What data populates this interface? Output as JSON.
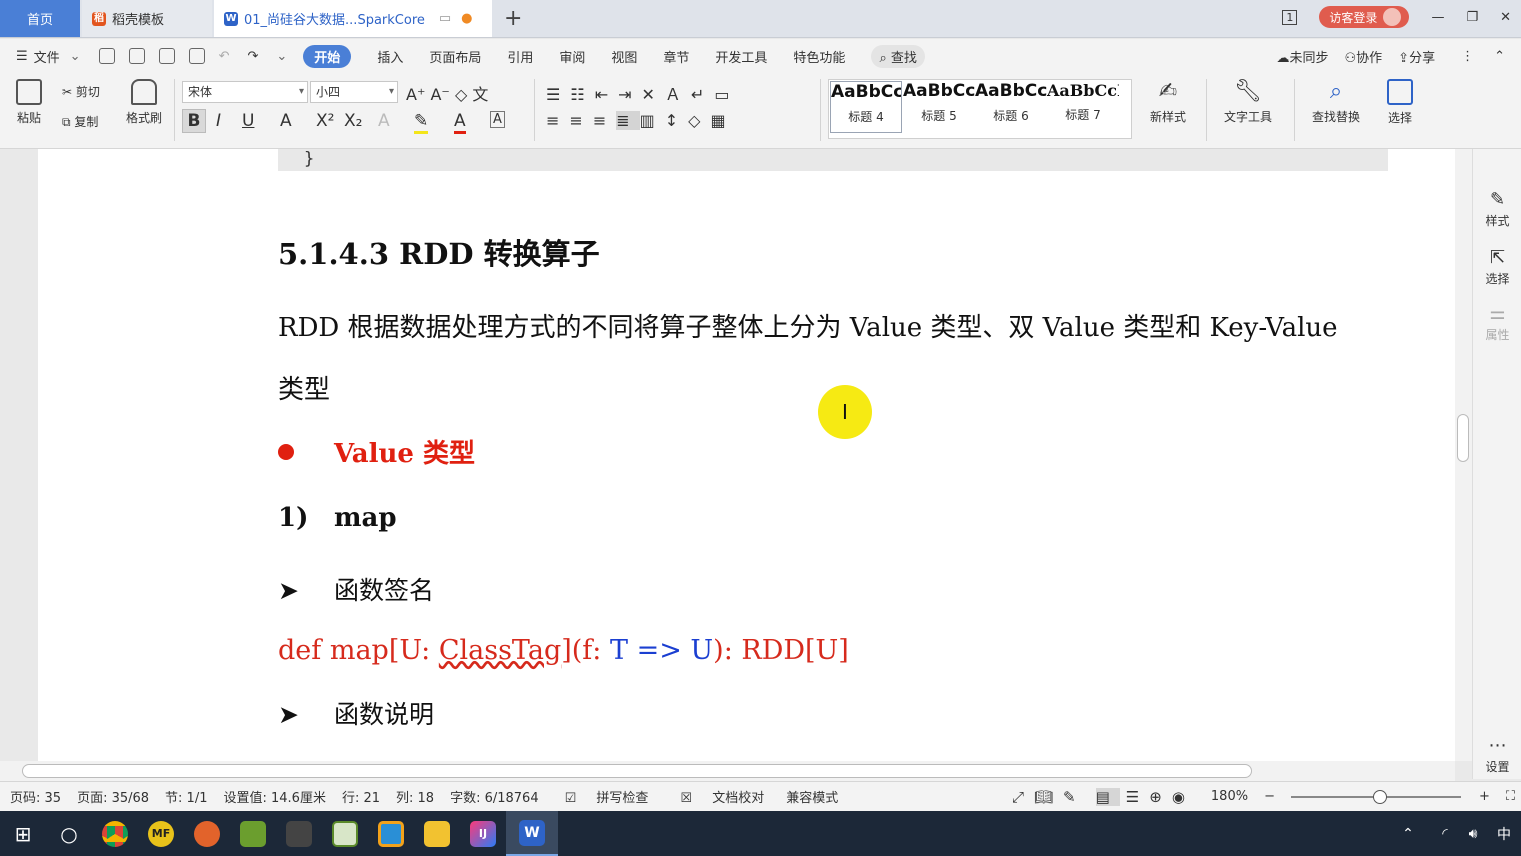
{
  "tabs": {
    "home": "首页",
    "template": "稻壳模板",
    "document": "01_尚硅谷大数据...SparkCore"
  },
  "window": {
    "page_badge": "1",
    "login": "访客登录"
  },
  "menu": {
    "file": "文件",
    "items": [
      "开始",
      "插入",
      "页面布局",
      "引用",
      "审阅",
      "视图",
      "章节",
      "开发工具",
      "特色功能"
    ],
    "search": "查找",
    "sync": "未同步",
    "collab": "协作",
    "share": "分享"
  },
  "ribbon": {
    "paste": "粘贴",
    "cut": "剪切",
    "copy": "复制",
    "format_painter": "格式刷",
    "font": "宋体",
    "size": "小四",
    "styles": [
      {
        "preview": "AaBbCc",
        "name": "标题 4"
      },
      {
        "preview": "AaBbCc",
        "name": "标题 5"
      },
      {
        "preview": "AaBbCc",
        "name": "标题 6"
      },
      {
        "preview": "AaBbCcD",
        "name": "标题 7"
      }
    ],
    "new_style": "新样式",
    "text_tools": "文字工具",
    "find_replace": "查找替换",
    "select": "选择"
  },
  "doc": {
    "code_brace": "}",
    "heading": "5.1.4.3 RDD 转换算子",
    "para_line1": "RDD 根据数据处理方式的不同将算子整体上分为 Value 类型、双 Value 类型和 Key-Value",
    "para_line2": "类型",
    "bullet": "Value 类型",
    "sub_num": "1)",
    "sub_title": "map",
    "arrow1": "函数签名",
    "sig_def": "def map[U: ",
    "sig_classtag": "ClassTag",
    "sig_mid": "](f: ",
    "sig_tu": "T => U",
    "sig_end": "): RDD[U]",
    "arrow2": "函数说明",
    "cursor_char": "I"
  },
  "right_panel": {
    "style": "样式",
    "select": "选择",
    "props": "属性",
    "settings": "设置"
  },
  "status": {
    "page_code": "页码: 35",
    "pages": "页面: 35/68",
    "section": "节: 1/1",
    "setting": "设置值: 14.6厘米",
    "row": "行: 21",
    "col": "列: 18",
    "words": "字数: 6/18764",
    "spell": "拼写检查",
    "proof": "文档校对",
    "compat": "兼容模式",
    "zoom": "180%"
  },
  "taskbar": {
    "ime": "中"
  },
  "colors": {
    "accent": "#4a7fd6",
    "red": "#d62a1c",
    "blue": "#1b3fd1",
    "highlight": "#f6ea13"
  }
}
